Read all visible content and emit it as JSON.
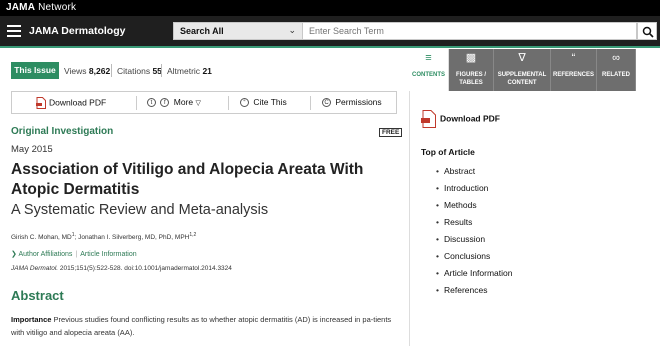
{
  "network": {
    "brand_bold": "JAMA",
    "brand_rest": " Network"
  },
  "header": {
    "journal_title": "JAMA Dermatology",
    "search_scope": "Search All",
    "search_placeholder": "Enter Search Term"
  },
  "meta": {
    "this_issue": "This Issue",
    "views_label": "Views",
    "views_value": "8,262",
    "citations_label": "Citations",
    "citations_value": "55",
    "altmetric_label": "Altmetric",
    "altmetric_value": "21"
  },
  "actions": {
    "download_pdf": "Download PDF",
    "more": "More",
    "cite_this": "Cite This",
    "permissions": "Permissions"
  },
  "article": {
    "type": "Original Investigation",
    "free": "FREE",
    "date": "May 2015",
    "title": "Association of Vitiligo and Alopecia Areata With Atopic Dermatitis",
    "subtitle": "A Systematic Review and Meta-analysis",
    "author1": "Girish C. Mohan, MD",
    "author1_sup": "1",
    "author2": "; Jonathan I. Silverberg, MD, PhD, MPH",
    "author2_sup": "1,2",
    "author_affiliations": "Author Affiliations",
    "article_information": "Article Information",
    "citation_journal": "JAMA Dermatol.",
    "citation_rest": " 2015;151(5):522-528. doi:10.1001/jamadermatol.2014.3324",
    "abstract_heading": "Abstract",
    "importance_label": "Importance",
    "importance_text": "  Previous studies found conflicting results as to whether atopic dermatitis (AD) is increased in pa-tients with vitiligo and alopecia areata (AA)."
  },
  "right_panel": {
    "tabs": [
      {
        "label": "CONTENTS",
        "icon": "list-icon"
      },
      {
        "label": "FIGURES / TABLES",
        "icon": "chart-icon"
      },
      {
        "label": "SUPPLEMENTAL CONTENT",
        "icon": "paperclip-icon"
      },
      {
        "label": "REFERENCES",
        "icon": "quote-icon"
      },
      {
        "label": "RELATED",
        "icon": "link-icon"
      }
    ],
    "download_pdf": "Download PDF",
    "toc_heading": "Top of Article",
    "toc_items": [
      "Abstract",
      "Introduction",
      "Methods",
      "Results",
      "Discussion",
      "Conclusions",
      "Article Information",
      "References"
    ]
  },
  "colors": {
    "accent_green": "#2d8d62",
    "title_green": "#2d7a55",
    "header_dark": "#1f1f1f"
  }
}
